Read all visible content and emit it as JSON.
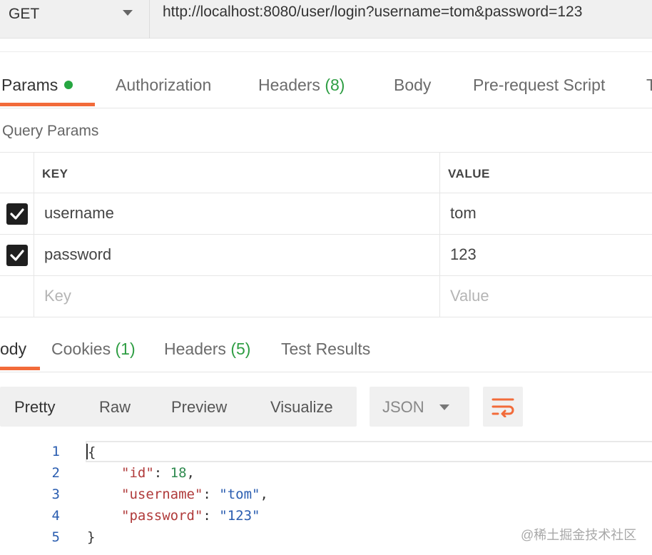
{
  "request": {
    "method": "GET",
    "url": "http://localhost:8080/user/login?username=tom&password=123"
  },
  "request_tabs": [
    {
      "label": "Params",
      "active": true,
      "indicator": "green-dot"
    },
    {
      "label": "Authorization"
    },
    {
      "label": "Headers",
      "count": "(8)"
    },
    {
      "label": "Body"
    },
    {
      "label": "Pre-request Script"
    },
    {
      "label": "T"
    }
  ],
  "query_params": {
    "title": "Query Params",
    "headers": {
      "key": "KEY",
      "value": "VALUE"
    },
    "rows": [
      {
        "checked": true,
        "key": "username",
        "value": "tom"
      },
      {
        "checked": true,
        "key": "password",
        "value": "123"
      }
    ],
    "empty_row": {
      "key_placeholder": "Key",
      "value_placeholder": "Value"
    }
  },
  "response_tabs": [
    {
      "label": "ody",
      "active": true
    },
    {
      "label": "Cookies",
      "count": "(1)"
    },
    {
      "label": "Headers",
      "count": "(5)"
    },
    {
      "label": "Test Results"
    }
  ],
  "response_toolbar": {
    "views": [
      "Pretty",
      "Raw",
      "Preview",
      "Visualize"
    ],
    "active_view": "Pretty",
    "format": "JSON",
    "wrap_icon": "wrap-lines-icon"
  },
  "response_body": {
    "lines": [
      {
        "num": "1",
        "text": "{"
      },
      {
        "num": "2",
        "key": "\"id\"",
        "sep": ": ",
        "value": "18",
        "value_type": "number",
        "trail": ","
      },
      {
        "num": "3",
        "key": "\"username\"",
        "sep": ": ",
        "value": "\"tom\"",
        "value_type": "string",
        "trail": ","
      },
      {
        "num": "4",
        "key": "\"password\"",
        "sep": ": ",
        "value": "\"123\"",
        "value_type": "string",
        "trail": ""
      },
      {
        "num": "5",
        "text": "}"
      }
    ]
  },
  "colors": {
    "accent": "#f26b3a",
    "success": "#26a641",
    "key": "#b03a3a",
    "string": "#2a5db0",
    "number": "#2f8a4f"
  },
  "watermark": "@稀土掘金技术社区"
}
